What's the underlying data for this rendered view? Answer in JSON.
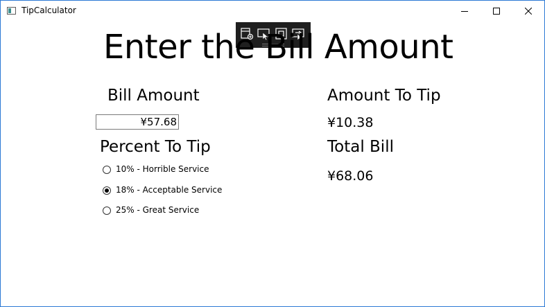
{
  "window": {
    "title": "TipCalculator"
  },
  "heading": "Enter the Bill Amount",
  "bill": {
    "label": "Bill Amount",
    "value": "¥57.68"
  },
  "percent": {
    "label": "Percent To Tip",
    "options": [
      {
        "label": "10% - Horrible Service",
        "checked": false
      },
      {
        "label": "18% - Acceptable Service",
        "checked": true
      },
      {
        "label": "25% - Great Service",
        "checked": false
      }
    ]
  },
  "tip": {
    "label": "Amount To Tip",
    "value": "¥10.38"
  },
  "total": {
    "label": "Total Bill",
    "value": "¥68.06"
  },
  "colors": {
    "window_border": "#2b78d4",
    "devbar": "#1f1f1f"
  },
  "icons": [
    "minimize-icon",
    "maximize-icon",
    "close-icon",
    "live-visual-tree-icon",
    "select-element-icon",
    "display-layout-adorners-icon",
    "track-focused-element-icon"
  ]
}
